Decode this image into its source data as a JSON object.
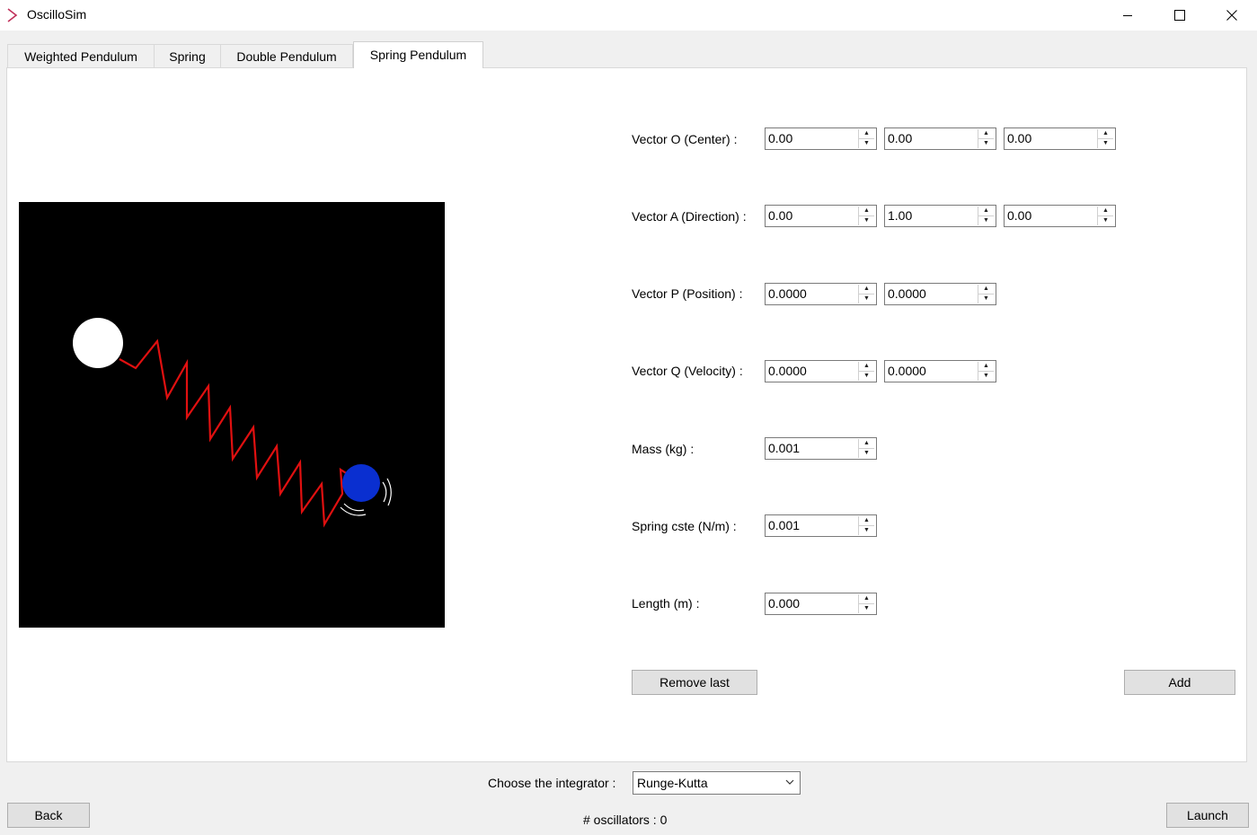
{
  "window": {
    "title": "OscilloSim",
    "minimize_icon": "minimize-icon",
    "maximize_icon": "maximize-icon",
    "close_icon": "close-icon"
  },
  "tabs": [
    {
      "label": "Weighted Pendulum"
    },
    {
      "label": "Spring"
    },
    {
      "label": "Double Pendulum"
    },
    {
      "label": "Spring Pendulum",
      "active": true
    }
  ],
  "form": {
    "vector_o": {
      "label": "Vector O (Center) :",
      "values": [
        "0.00",
        "0.00",
        "0.00"
      ]
    },
    "vector_a": {
      "label": "Vector A (Direction) :",
      "values": [
        "0.00",
        "1.00",
        "0.00"
      ]
    },
    "vector_p": {
      "label": "Vector P (Position) :",
      "values": [
        "0.0000",
        "0.0000"
      ]
    },
    "vector_q": {
      "label": "Vector Q (Velocity) :",
      "values": [
        "0.0000",
        "0.0000"
      ]
    },
    "mass": {
      "label": "Mass (kg) :",
      "value": "0.001"
    },
    "spring_cste": {
      "label": "Spring cste (N/m) :",
      "value": "0.001"
    },
    "length": {
      "label": "Length (m) :",
      "value": "0.000"
    },
    "remove_last_label": "Remove last",
    "add_label": "Add"
  },
  "preview": {
    "anchor_color": "#ffffff",
    "spring_color": "#e01010",
    "mass_color": "#0a2fd0",
    "background_color": "#000000"
  },
  "bottom": {
    "integrator_label": "Choose the integrator :",
    "integrator_value": "Runge-Kutta",
    "oscillators_label": "# oscillators : 0",
    "back_label": "Back",
    "launch_label": "Launch"
  }
}
